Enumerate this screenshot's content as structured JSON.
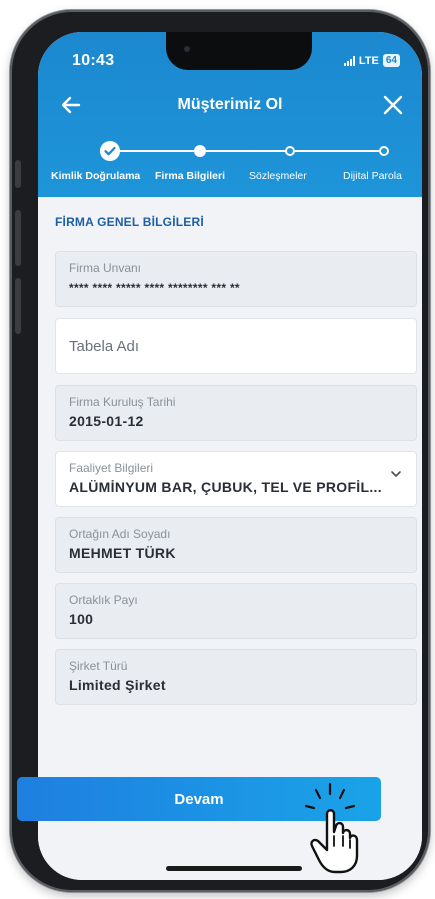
{
  "status_bar": {
    "time": "10:43",
    "network": "LTE",
    "battery": "64"
  },
  "header": {
    "title": "Müşterimiz Ol"
  },
  "stepper": {
    "steps": [
      {
        "label": "Kimlik Doğrulama",
        "state": "done"
      },
      {
        "label": "Firma Bilgileri",
        "state": "current"
      },
      {
        "label": "Sözleşmeler",
        "state": "todo"
      },
      {
        "label": "Dijital Parola",
        "state": "todo"
      }
    ]
  },
  "section": {
    "title": "FİRMA GENEL BİLGİLERİ"
  },
  "fields": {
    "company_title": {
      "label": "Firma Unvanı",
      "value": "**** **** ***** **** ******** *** **"
    },
    "sign_name": {
      "placeholder": "Tabela Adı"
    },
    "founding_date": {
      "label": "Firma Kuruluş Tarihi",
      "value": "2015-01-12"
    },
    "activity": {
      "label": "Faaliyet Bilgileri",
      "value": "ALÜMİNYUM BAR, ÇUBUK, TEL VE PROFİL..."
    },
    "partner_name": {
      "label": "Ortağın Adı Soyadı",
      "value": "MEHMET TÜRK"
    },
    "partner_share": {
      "label": "Ortaklık Payı",
      "value": "100"
    },
    "company_type": {
      "label": "Şirket Türü",
      "value": "Limited Şirket"
    }
  },
  "actions": {
    "continue_label": "Devam"
  },
  "colors": {
    "header_blue": "#1c88cf",
    "section_title": "#1b5fa8",
    "cta_start": "#1e7fe0",
    "cta_end": "#1aa3e8"
  }
}
